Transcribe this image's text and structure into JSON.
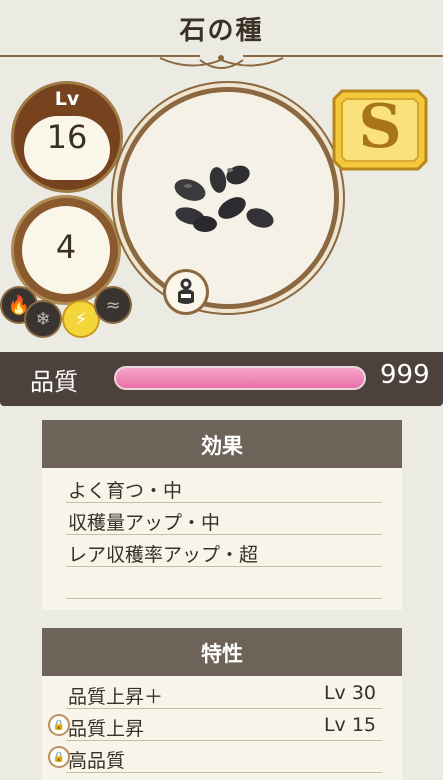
{
  "item": {
    "name": "石の種",
    "level_label": "Lv",
    "level": "16",
    "count": "4",
    "rank": "S"
  },
  "elements": [
    {
      "icon": "fire-icon",
      "glyph": "🔥",
      "active": false
    },
    {
      "icon": "snowflake-icon",
      "glyph": "❄",
      "active": false
    },
    {
      "icon": "lightning-icon",
      "glyph": "⚡",
      "active": true
    },
    {
      "icon": "wind-icon",
      "glyph": "≈",
      "active": false
    }
  ],
  "quality": {
    "label": "品質",
    "value": "999",
    "fill": 1.0,
    "bar_color": "#e86fa5"
  },
  "effects": {
    "title": "効果",
    "rows": [
      "よく育つ・中",
      "収穫量アップ・中",
      "レア収穫率アップ・超",
      ""
    ]
  },
  "traits": {
    "title": "特性",
    "rows": [
      {
        "label": "品質上昇＋",
        "level": "Lv 30",
        "locked": false
      },
      {
        "label": "品質上昇",
        "level": "Lv 15",
        "locked": true
      },
      {
        "label": "高品質",
        "level": "",
        "locked": true
      }
    ]
  }
}
